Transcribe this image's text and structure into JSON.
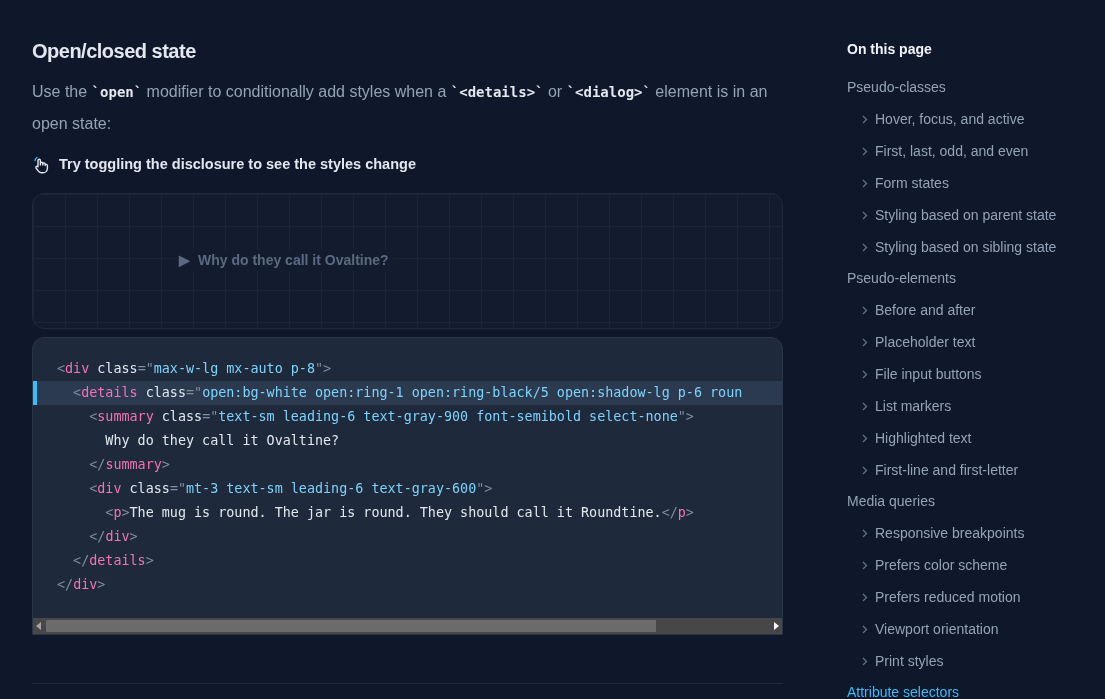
{
  "heading": "Open/closed state",
  "intro": [
    {
      "kind": "text",
      "text": "Use the "
    },
    {
      "kind": "code",
      "text": "`open`"
    },
    {
      "kind": "text",
      "text": " modifier to conditionally add styles when a "
    },
    {
      "kind": "code",
      "text": "`<details>`"
    },
    {
      "kind": "text",
      "text": " or "
    },
    {
      "kind": "code",
      "text": "`<dialog>`"
    },
    {
      "kind": "text",
      "text": " element is in an open state:"
    }
  ],
  "hint": "Try toggling the disclosure to see the styles change",
  "preview": {
    "marker": "▶",
    "summary": "Why do they call it Ovaltine?"
  },
  "code_lines": [
    {
      "selected": false,
      "tokens": [
        {
          "kind": "punct",
          "text": "<"
        },
        {
          "kind": "tag",
          "text": "div"
        },
        {
          "kind": "attr",
          "text": " class"
        },
        {
          "kind": "punct",
          "text": "=\""
        },
        {
          "kind": "string",
          "text": "max-w-lg mx-auto p-8"
        },
        {
          "kind": "punct",
          "text": "\">"
        }
      ]
    },
    {
      "selected": true,
      "tokens": [
        {
          "kind": "punct",
          "text": "  <"
        },
        {
          "kind": "tag",
          "text": "details"
        },
        {
          "kind": "attr",
          "text": " class"
        },
        {
          "kind": "punct",
          "text": "=\""
        },
        {
          "kind": "string",
          "text": "open:bg-white open:ring-1 open:ring-black/5 open:shadow-lg p-6 roun"
        }
      ]
    },
    {
      "selected": false,
      "tokens": [
        {
          "kind": "punct",
          "text": "    <"
        },
        {
          "kind": "tag",
          "text": "summary"
        },
        {
          "kind": "attr",
          "text": " class"
        },
        {
          "kind": "punct",
          "text": "=\""
        },
        {
          "kind": "string",
          "text": "text-sm leading-6 text-gray-900 font-semibold select-none"
        },
        {
          "kind": "punct",
          "text": "\">"
        }
      ]
    },
    {
      "selected": false,
      "tokens": [
        {
          "kind": "text",
          "text": "      Why do they call it Ovaltine?"
        }
      ]
    },
    {
      "selected": false,
      "tokens": [
        {
          "kind": "punct",
          "text": "    </"
        },
        {
          "kind": "tag",
          "text": "summary"
        },
        {
          "kind": "punct",
          "text": ">"
        }
      ]
    },
    {
      "selected": false,
      "tokens": [
        {
          "kind": "punct",
          "text": "    <"
        },
        {
          "kind": "tag",
          "text": "div"
        },
        {
          "kind": "attr",
          "text": " class"
        },
        {
          "kind": "punct",
          "text": "=\""
        },
        {
          "kind": "string",
          "text": "mt-3 text-sm leading-6 text-gray-600"
        },
        {
          "kind": "punct",
          "text": "\">"
        }
      ]
    },
    {
      "selected": false,
      "tokens": [
        {
          "kind": "punct",
          "text": "      <"
        },
        {
          "kind": "tag",
          "text": "p"
        },
        {
          "kind": "punct",
          "text": ">"
        },
        {
          "kind": "text",
          "text": "The mug is round. The jar is round. They should call it Roundtine."
        },
        {
          "kind": "punct",
          "text": "</"
        },
        {
          "kind": "tag",
          "text": "p"
        },
        {
          "kind": "punct",
          "text": ">"
        }
      ]
    },
    {
      "selected": false,
      "tokens": [
        {
          "kind": "punct",
          "text": "    </"
        },
        {
          "kind": "tag",
          "text": "div"
        },
        {
          "kind": "punct",
          "text": ">"
        }
      ]
    },
    {
      "selected": false,
      "tokens": [
        {
          "kind": "punct",
          "text": "  </"
        },
        {
          "kind": "tag",
          "text": "details"
        },
        {
          "kind": "punct",
          "text": ">"
        }
      ]
    },
    {
      "selected": false,
      "tokens": [
        {
          "kind": "punct",
          "text": "</"
        },
        {
          "kind": "tag",
          "text": "div"
        },
        {
          "kind": "punct",
          "text": ">"
        }
      ]
    }
  ],
  "toc": {
    "title": "On this page",
    "sections": [
      {
        "label": "Pseudo-classes",
        "selected": false,
        "children": [
          {
            "label": "Hover, focus, and active"
          },
          {
            "label": "First, last, odd, and even"
          },
          {
            "label": "Form states"
          },
          {
            "label": "Styling based on parent state"
          },
          {
            "label": "Styling based on sibling state"
          }
        ]
      },
      {
        "label": "Pseudo-elements",
        "selected": false,
        "children": [
          {
            "label": "Before and after"
          },
          {
            "label": "Placeholder text"
          },
          {
            "label": "File input buttons"
          },
          {
            "label": "List markers"
          },
          {
            "label": "Highlighted text"
          },
          {
            "label": "First-line and first-letter"
          }
        ]
      },
      {
        "label": "Media queries",
        "selected": false,
        "children": [
          {
            "label": "Responsive breakpoints"
          },
          {
            "label": "Prefers color scheme"
          },
          {
            "label": "Prefers reduced motion"
          },
          {
            "label": "Viewport orientation"
          },
          {
            "label": "Print styles"
          }
        ]
      },
      {
        "label": "Attribute selectors",
        "selected": true
      }
    ]
  }
}
